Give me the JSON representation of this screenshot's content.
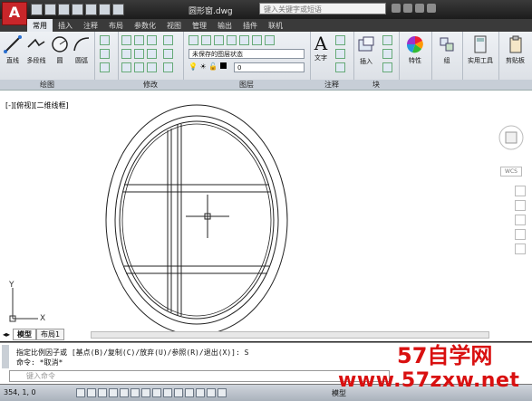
{
  "app": {
    "logo": "A",
    "file_title": "圆形窗.dwg",
    "search_placeholder": "键入关键字或短语"
  },
  "ribbon_tabs": [
    {
      "label": "常用"
    },
    {
      "label": "插入"
    },
    {
      "label": "注释"
    },
    {
      "label": "布局"
    },
    {
      "label": "参数化"
    },
    {
      "label": "视图"
    },
    {
      "label": "管理"
    },
    {
      "label": "输出"
    },
    {
      "label": "插件"
    },
    {
      "label": "联机"
    }
  ],
  "draw_panel": {
    "title": "绘图",
    "line": "直线",
    "polyline": "多段线",
    "circle": "圆",
    "arc": "圆弧"
  },
  "modify_panel": {
    "title": "修改"
  },
  "layers_panel": {
    "title": "图层",
    "layer_state": "未保存的图层状态",
    "current_layer": "0"
  },
  "annotation_panel": {
    "title": "注释",
    "text": "文字"
  },
  "block_panel": {
    "title": "块",
    "insert": "插入"
  },
  "properties_panel": {
    "label": "特性"
  },
  "groups_panel": {
    "label": "组"
  },
  "utilities_panel": {
    "label": "实用工具"
  },
  "clipboard_panel": {
    "label": "剪贴板"
  },
  "viewport": {
    "label": "[-][俯视][二维线框]",
    "wcs": "WCS",
    "ucs_y": "Y",
    "ucs_x": "X"
  },
  "layout_tabs": [
    {
      "label": "模型"
    },
    {
      "label": "布局1"
    }
  ],
  "command": {
    "history_1": "指定比例因子或 [基点(B)/复制(C)/放弃(U)/参照(R)/退出(X)]: S",
    "history_2": "命令: *取消*",
    "input_placeholder": "键入命令"
  },
  "status_bar": {
    "coordinates": "354, 1, 0",
    "model_label": "模型"
  },
  "watermark": {
    "brand": "57自学网",
    "url": "www.57zxw.net"
  },
  "colors": {
    "accent_red": "#d91010",
    "ribbon_bg": "#e6eaf0"
  }
}
